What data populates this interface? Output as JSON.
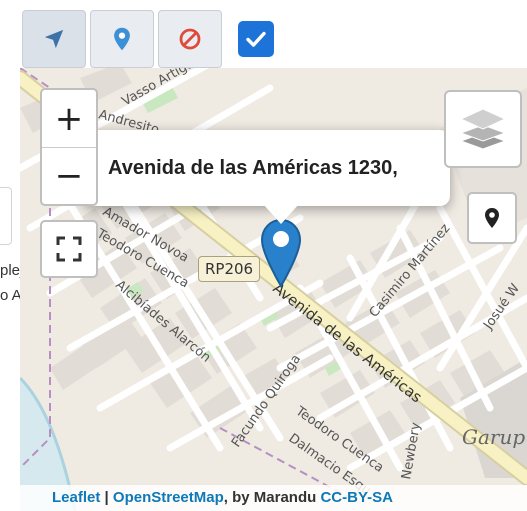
{
  "toolbar": {
    "buttons": [
      {
        "name": "navigate-button",
        "icon": "navigation-arrow-icon"
      },
      {
        "name": "pin-button",
        "icon": "map-pin-icon"
      },
      {
        "name": "clear-button",
        "icon": "prohibited-icon"
      }
    ],
    "checkbox_checked": true
  },
  "left_edge": {
    "fragment_1": "plejo",
    "fragment_2": "o Artigas"
  },
  "map": {
    "popup": {
      "text": "Avenida de las Américas 1230,"
    },
    "route_shield": "RP206",
    "controls": {
      "zoom_in": "+",
      "zoom_out": "−",
      "fullscreen_icon": "fullscreen-icon",
      "layers_icon": "layers-icon",
      "locate_icon": "map-pin-icon"
    },
    "labels": {
      "vasso_artigas": "Vasso Artigas",
      "andresito": "Andresito",
      "amador_novoa": "Amador Novoa",
      "teodoro_cuenca_1": "Teodoro Cuenca",
      "alcibiades": "Alcibíades Alarcón",
      "avenida": "Avenida de las Américas",
      "casimiro": "Casimiro Martínez",
      "josue": "Josué W",
      "facundo": "Facundo Quiroga",
      "teodoro_cuenca_2": "Teodoro Cuenca",
      "dalmacio": "Dalmacio Esqu",
      "newbery": "Newbery",
      "garupa": "Garup"
    },
    "attribution": {
      "leaflet": "Leaflet",
      "sep": " | ",
      "osm": "OpenStreetMap",
      "by": ", by Marandu ",
      "license": "CC-BY-SA"
    },
    "colors": {
      "background": "#efeae2",
      "block": "#e1ddd6",
      "street": "#ffffff",
      "avenue": "#f7f1c4",
      "park": "#c9e8c0",
      "water": "#aad3df",
      "marker": "#2a81cb",
      "boundary": "#b78fc2"
    }
  }
}
